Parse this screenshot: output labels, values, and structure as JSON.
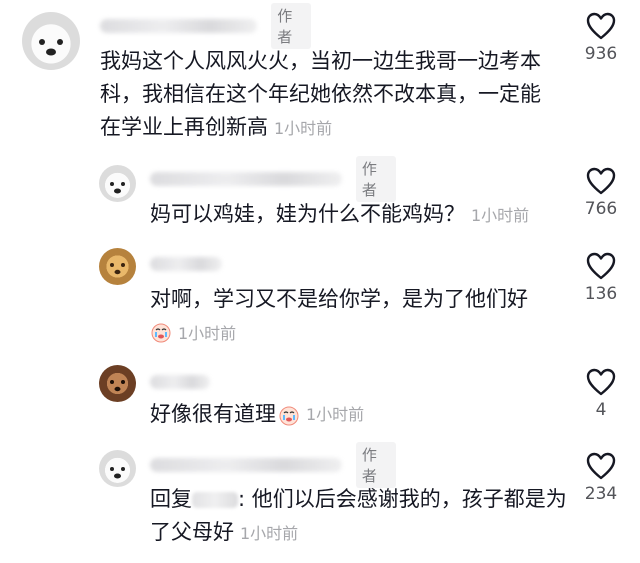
{
  "author_tag": "作者",
  "comments": [
    {
      "text": "我妈这个人风风火火，当初一边生我哥一边考本科，我相信在这个年纪她依然不改本真，一定能在学业上再创新高",
      "time": "1小时前",
      "likes": "936",
      "is_author": true
    },
    {
      "text": "妈可以鸡娃，娃为什么不能鸡妈？",
      "time": "1小时前",
      "likes": "766",
      "is_author": true
    },
    {
      "text": "对啊，学习又不是给你学，是为了他们好",
      "time": "1小时前",
      "likes": "136",
      "is_author": false
    },
    {
      "text": "好像很有道理",
      "time": "1小时前",
      "likes": "4",
      "is_author": false
    },
    {
      "text_prefix": "回复",
      "text": ": 他们以后会感谢我的，孩子都是为了父母好",
      "time": "1小时前",
      "likes": "234",
      "is_author": true
    }
  ]
}
